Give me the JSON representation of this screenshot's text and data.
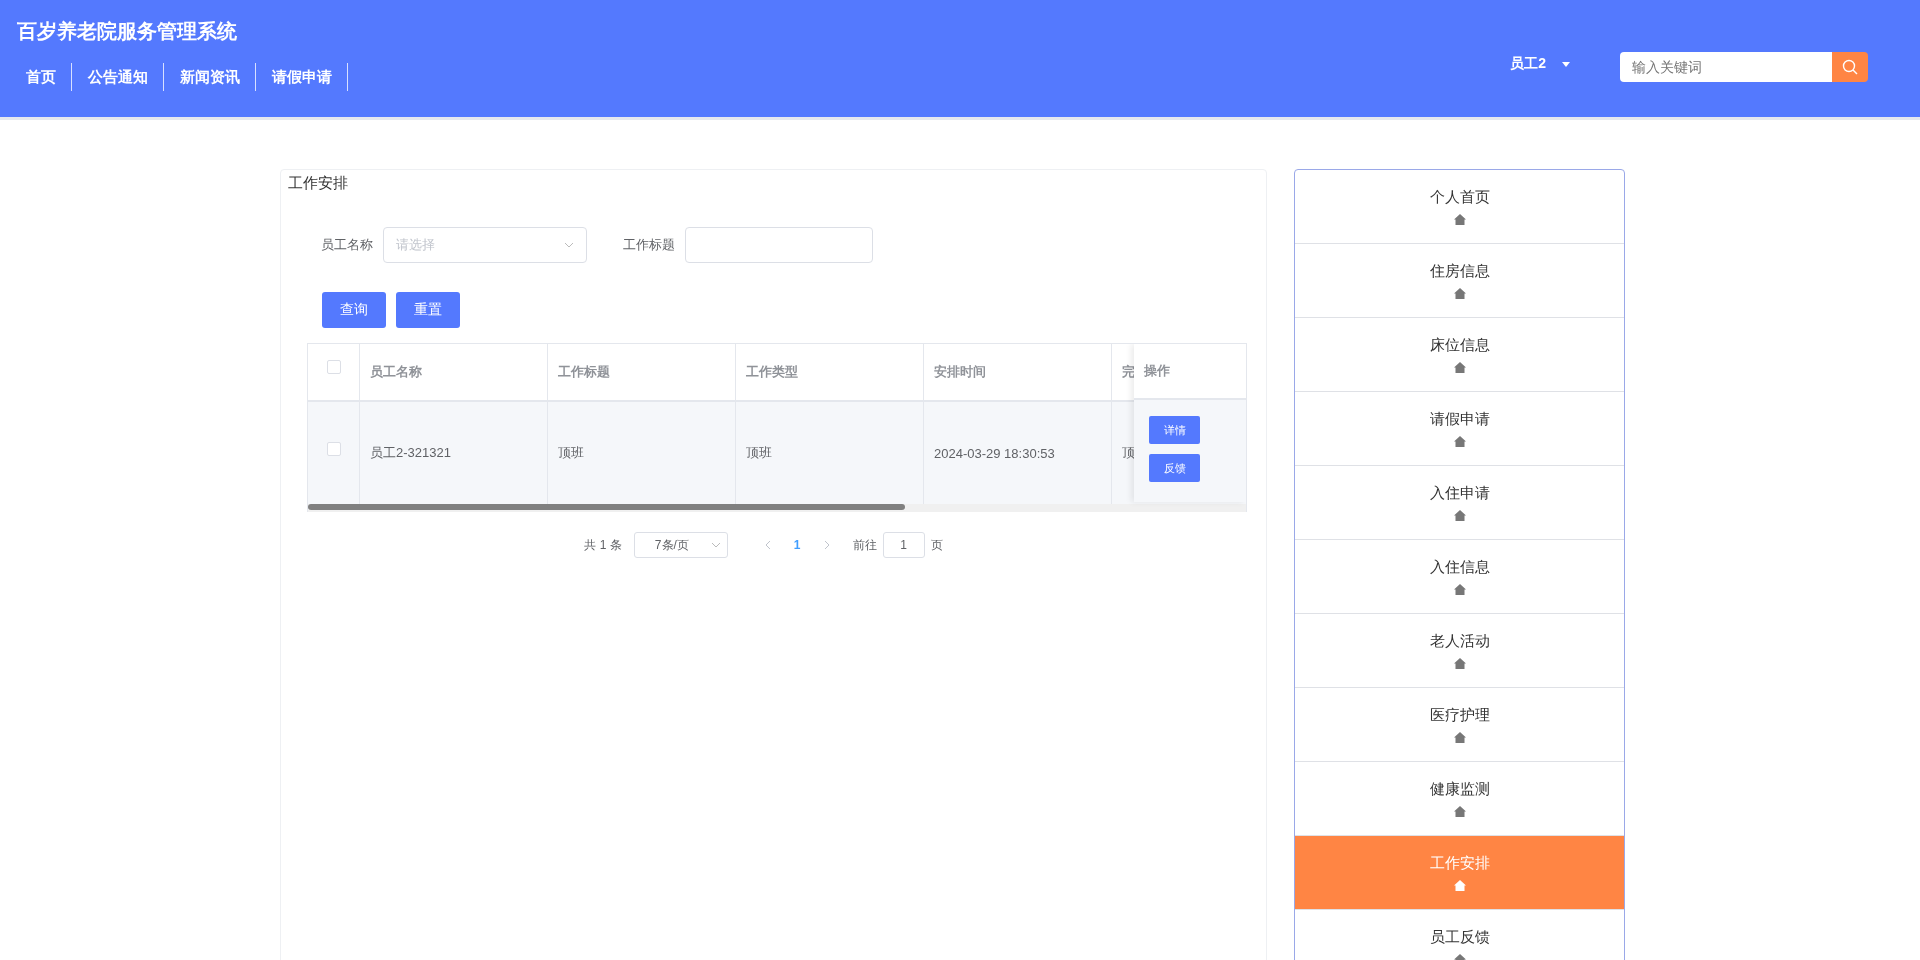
{
  "header": {
    "title": "百岁养老院服务管理系统",
    "nav": [
      {
        "label": "首页"
      },
      {
        "label": "公告通知"
      },
      {
        "label": "新闻资讯"
      },
      {
        "label": "请假申请"
      }
    ],
    "user": "员工2",
    "search": {
      "placeholder": "输入关键词"
    }
  },
  "panel": {
    "title": "工作安排",
    "filters": [
      {
        "kind": "select",
        "label": "员工名称",
        "placeholder": "请选择"
      },
      {
        "kind": "text",
        "label": "工作标题"
      }
    ],
    "buttons": [
      "查询",
      "重置"
    ],
    "table": {
      "select_all_checked": false,
      "columns": [
        "员工名称",
        "工作标题",
        "工作类型",
        "安排时间",
        "完"
      ],
      "action_column": "操作",
      "rows": [
        {
          "checked": false,
          "cells": [
            "员工2-321321",
            "顶班",
            "顶班",
            "2024-03-29 18:30:53",
            "顶"
          ],
          "actions": [
            "详情",
            "反馈"
          ]
        }
      ]
    },
    "pagination": {
      "total": "共 1 条",
      "page_size": "7条/页",
      "pages": [
        {
          "label": "1",
          "selected": true
        }
      ],
      "goto_label": "前往",
      "goto_value": "1",
      "goto_suffix": "页"
    }
  },
  "sidebar": {
    "items": [
      {
        "label": "个人首页",
        "selected": false
      },
      {
        "label": "住房信息",
        "selected": false
      },
      {
        "label": "床位信息",
        "selected": false
      },
      {
        "label": "请假申请",
        "selected": false
      },
      {
        "label": "入住申请",
        "selected": false
      },
      {
        "label": "入住信息",
        "selected": false
      },
      {
        "label": "老人活动",
        "selected": false
      },
      {
        "label": "医疗护理",
        "selected": false
      },
      {
        "label": "健康监测",
        "selected": false
      },
      {
        "label": "工作安排",
        "selected": true
      },
      {
        "label": "员工反馈",
        "selected": false
      }
    ]
  }
}
